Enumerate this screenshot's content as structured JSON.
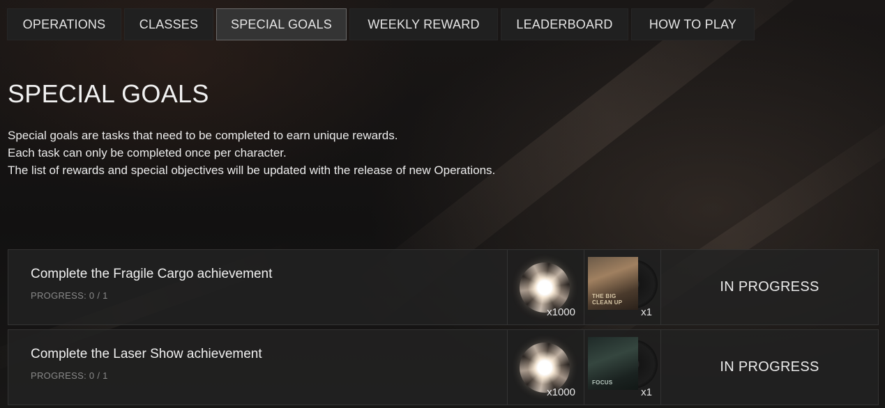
{
  "tabs": [
    {
      "label": "OPERATIONS"
    },
    {
      "label": "CLASSES"
    },
    {
      "label": "SPECIAL GOALS",
      "active": true
    },
    {
      "label": "WEEKLY REWARD"
    },
    {
      "label": "LEADERBOARD"
    },
    {
      "label": "HOW TO PLAY"
    }
  ],
  "page": {
    "title": "SPECIAL GOALS",
    "description": [
      "Special goals are tasks that need to be completed to earn unique rewards.",
      "Each task can only be completed once per character.",
      "The list of rewards and special objectives will be updated with the release of new Operations."
    ]
  },
  "goals": [
    {
      "name": "Complete the Fragile Cargo achievement",
      "progress": "PROGRESS: 0 / 1",
      "rewards": [
        {
          "icon": "energy-orb-icon",
          "qty": "x1000"
        },
        {
          "icon": "album-the-big-clean-up-icon",
          "cover_text": "THE BIG CLEAN UP",
          "qty": "x1"
        }
      ],
      "status": "IN PROGRESS"
    },
    {
      "name": "Complete the Laser Show achievement",
      "progress": "PROGRESS: 0 / 1",
      "rewards": [
        {
          "icon": "energy-orb-icon",
          "qty": "x1000"
        },
        {
          "icon": "album-focus-icon",
          "cover_text": "FOCUS",
          "qty": "x1"
        }
      ],
      "status": "IN PROGRESS"
    }
  ],
  "colors": {
    "background": "#141414",
    "tab": "#202020",
    "tab_active": "#343434",
    "row": "#222222",
    "muted_text": "#8a8a8a"
  }
}
